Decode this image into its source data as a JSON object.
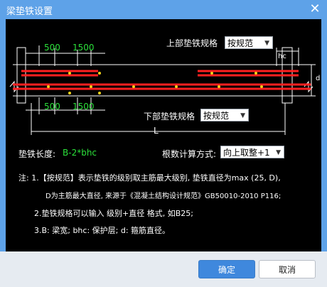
{
  "dialog": {
    "title": "梁垫铁设置",
    "close_icon": "close-icon"
  },
  "diagram": {
    "top_spec_label": "上部垫铁规格",
    "top_spec_value": "按规范",
    "bottom_spec_label": "下部垫铁规格",
    "bottom_spec_value": "按规范",
    "dim_top_left": "500",
    "dim_top_right": "1500",
    "dim_bottom_left": "500",
    "dim_bottom_right": "1500",
    "hc_label": "hc",
    "L_label": "L",
    "d_label": "d"
  },
  "length": {
    "label": "垫铁长度:",
    "value": "B-2*bhc"
  },
  "rounding": {
    "label": "根数计算方式:",
    "value": "向上取整+1"
  },
  "notes": {
    "line1": "注: 1.【按规范】表示垫铁的级别取主筋最大级别, 垫铁直径为max (25, D),",
    "line2": "D为主筋最大直径, 来源于《混凝土结构设计规范》GB50010-2010 P116;",
    "line3": "2.垫铁规格可以输入 级别+直径 格式, 如B25;",
    "line4": "3.B: 梁宽; bhc: 保护层; d: 箍筋直径。"
  },
  "buttons": {
    "ok": "确定",
    "cancel": "取消"
  },
  "colors": {
    "title_bar": "#5ea2e8",
    "canvas": "#000000",
    "rebar_red": "#ff2020",
    "dot_yellow": "#f2d21a",
    "dim_green": "#2be03a",
    "ok_button": "#3f88dd"
  }
}
